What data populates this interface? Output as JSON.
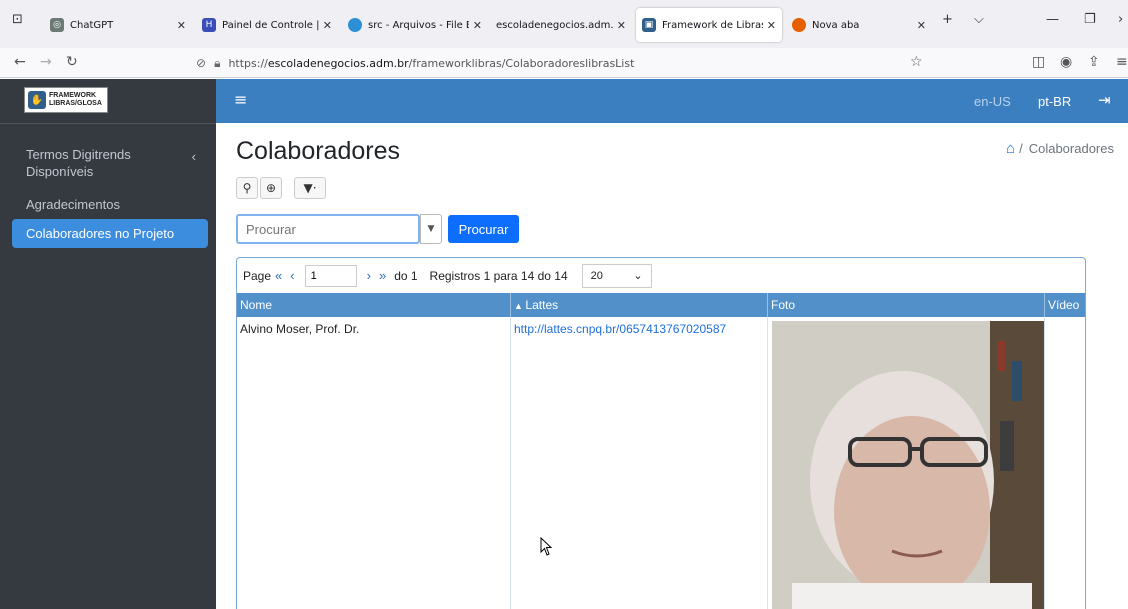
{
  "browser": {
    "tabs": [
      {
        "title": "ChatGPT",
        "favicon_color": "#6b7a74"
      },
      {
        "title": "Painel de Controle | H",
        "favicon_color": "#3b4db6"
      },
      {
        "title": "src - Arquivos - File Br",
        "favicon_color": "#2d8fd5"
      },
      {
        "title": "escoladenegocios.adm.br/",
        "favicon_color": "#999999"
      },
      {
        "title": "Framework de Libras/C",
        "favicon_color": "#2f5f8a"
      },
      {
        "title": "Nova aba",
        "favicon_color": "#e66000"
      }
    ],
    "url_prefix": "https://",
    "url_host": "escoladenegocios.adm.br",
    "url_path": "/frameworklibras/ColaboradoreslibrasList"
  },
  "app": {
    "logo_line1": "FRAMEWORK",
    "logo_line2": "LIBRAS/GLOSA",
    "lang_en": "en-US",
    "lang_pt": "pt-BR",
    "sidebar": [
      {
        "label": "Termos Digitrends Disponíveis"
      },
      {
        "label": "Agradecimentos"
      },
      {
        "label": "Colaboradores no Projeto"
      }
    ],
    "page_title": "Colaboradores",
    "breadcrumb": "Colaboradores",
    "search_placeholder": "Procurar",
    "search_button": "Procurar",
    "pager": {
      "label": "Page",
      "current": "1",
      "of": "do 1",
      "records": "Registros 1 para 14 do 14",
      "page_size": "20"
    },
    "columns": [
      "Nome",
      "Lattes",
      "Foto",
      "Vídeo"
    ],
    "rows": [
      {
        "nome": "Alvino Moser, Prof. Dr.",
        "lattes": "http://lattes.cnpq.br/0657413767020587"
      }
    ]
  },
  "colors": {
    "topbar": "#3c7fc0",
    "sidebar": "#343a40",
    "active_item": "#3c8dde",
    "header": "#5290c9",
    "primary_button": "#0d6efd"
  }
}
